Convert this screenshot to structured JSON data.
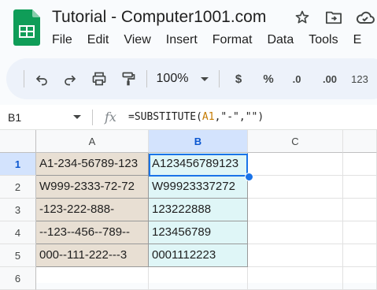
{
  "app": {
    "title": "Tutorial - Computer1001.com",
    "title_icons": [
      "star-icon",
      "move-to-folder-icon",
      "cloud-status-icon"
    ]
  },
  "menu": [
    "File",
    "Edit",
    "View",
    "Insert",
    "Format",
    "Data",
    "Tools",
    "E"
  ],
  "toolbar": {
    "zoom": "100%",
    "currency": "$",
    "percent": "%",
    "decrease_decimal": ".0",
    "increase_decimal": ".00",
    "number_format": "123",
    "buttons": [
      "undo-icon",
      "redo-icon",
      "print-icon",
      "paint-format-icon"
    ]
  },
  "formula_bar": {
    "name_box": "B1",
    "fx": "fx",
    "formula_prefix": "=SUBSTITUTE(",
    "formula_ref": "A1",
    "formula_suffix": ",\"-\",\"\")"
  },
  "grid": {
    "columns": [
      "A",
      "B",
      "C"
    ],
    "selected_column": "B",
    "selected_row": "1",
    "rows": [
      {
        "num": "1",
        "a": "A1-234-56789-123",
        "b": "A123456789123"
      },
      {
        "num": "2",
        "a": "W999-2333-72-72",
        "b": "W99923337272"
      },
      {
        "num": "3",
        "a": "-123-222-888-",
        "b": "123222888"
      },
      {
        "num": "4",
        "a": "--123--456--789--",
        "b": "123456789"
      },
      {
        "num": "5",
        "a": "000--111-222---3",
        "b": "0001112223"
      },
      {
        "num": "6",
        "a": "",
        "b": ""
      }
    ]
  },
  "colors": {
    "accent": "#1a73e8",
    "logo_green": "#0f9d58",
    "col_a_fill": "#e8dfd3",
    "col_b_fill": "#dff6f7",
    "selection_header": "#d3e3fd"
  }
}
